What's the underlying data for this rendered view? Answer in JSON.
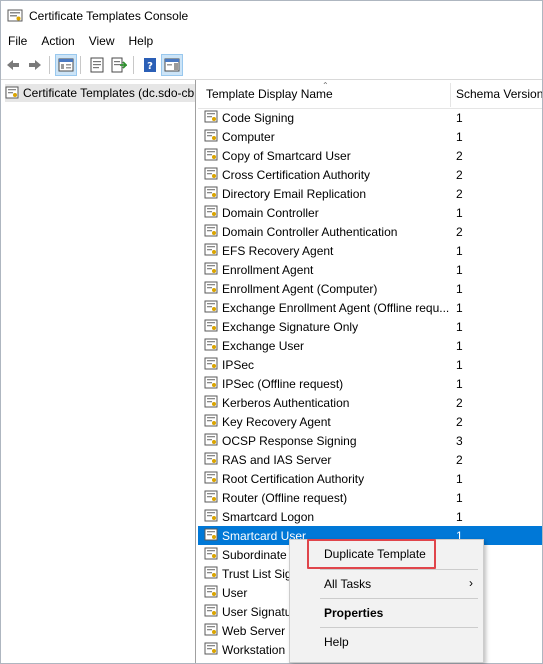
{
  "window": {
    "title": "Certificate Templates Console"
  },
  "menu": [
    "File",
    "Action",
    "View",
    "Help"
  ],
  "toolbar": {
    "buttons": [
      "back-icon",
      "forward-icon",
      "show-hide-tree-icon",
      "properties-icon",
      "export-list-icon",
      "help-icon",
      "show-hide-action-pane-icon"
    ]
  },
  "tree": {
    "root_label": "Certificate Templates (dc.sdo-cb"
  },
  "list": {
    "columns": [
      "Template Display Name",
      "Schema Version"
    ],
    "rows": [
      {
        "name": "Code Signing",
        "version": "1"
      },
      {
        "name": "Computer",
        "version": "1"
      },
      {
        "name": "Copy of Smartcard User",
        "version": "2"
      },
      {
        "name": "Cross Certification Authority",
        "version": "2"
      },
      {
        "name": "Directory Email Replication",
        "version": "2"
      },
      {
        "name": "Domain Controller",
        "version": "1"
      },
      {
        "name": "Domain Controller Authentication",
        "version": "2"
      },
      {
        "name": "EFS Recovery Agent",
        "version": "1"
      },
      {
        "name": "Enrollment Agent",
        "version": "1"
      },
      {
        "name": "Enrollment Agent (Computer)",
        "version": "1"
      },
      {
        "name": "Exchange Enrollment Agent (Offline requ...",
        "version": "1"
      },
      {
        "name": "Exchange Signature Only",
        "version": "1"
      },
      {
        "name": "Exchange User",
        "version": "1"
      },
      {
        "name": "IPSec",
        "version": "1"
      },
      {
        "name": "IPSec (Offline request)",
        "version": "1"
      },
      {
        "name": "Kerberos Authentication",
        "version": "2"
      },
      {
        "name": "Key Recovery Agent",
        "version": "2"
      },
      {
        "name": "OCSP Response Signing",
        "version": "3"
      },
      {
        "name": "RAS and IAS Server",
        "version": "2"
      },
      {
        "name": "Root Certification Authority",
        "version": "1"
      },
      {
        "name": "Router (Offline request)",
        "version": "1"
      },
      {
        "name": "Smartcard Logon",
        "version": "1"
      },
      {
        "name": "Smartcard User",
        "version": "1"
      },
      {
        "name": "Subordinate",
        "version": ""
      },
      {
        "name": "Trust List Sig",
        "version": ""
      },
      {
        "name": "User",
        "version": ""
      },
      {
        "name": "User Signatu",
        "version": ""
      },
      {
        "name": "Web Server",
        "version": ""
      },
      {
        "name": "Workstation",
        "version": ""
      }
    ],
    "selected_index": 22
  },
  "context_menu": {
    "items": [
      "Duplicate Template",
      "All Tasks",
      "Properties",
      "Help"
    ]
  },
  "colors": {
    "selection": "#0078d7",
    "highlight_box": "#e0454b"
  }
}
